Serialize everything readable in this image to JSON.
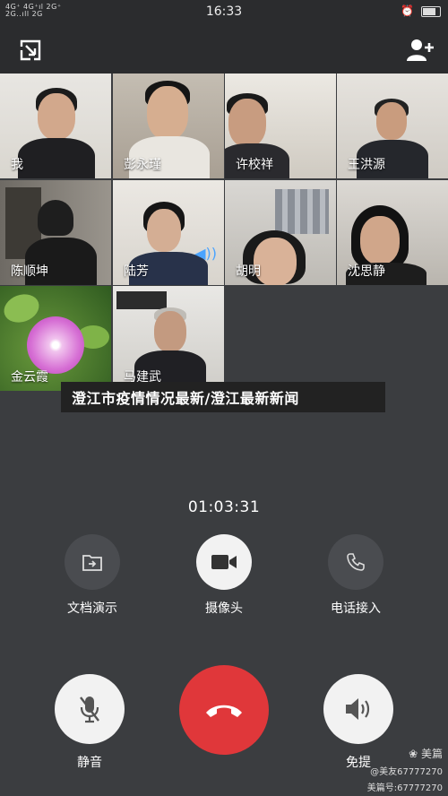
{
  "status_bar": {
    "signal_text_top": "4G+ 4G⁺ıl 2G",
    "signal_text_bottom": "4G+ 2G..ıll 2G",
    "time": "16:33"
  },
  "participants": [
    {
      "name": "我"
    },
    {
      "name": "彭永瑾"
    },
    {
      "name": "许校祥"
    },
    {
      "name": "王洪源"
    },
    {
      "name": "陈顺坤"
    },
    {
      "name": "陆芳"
    },
    {
      "name": "胡明"
    },
    {
      "name": "沈思静"
    },
    {
      "name": "金云霞"
    },
    {
      "name": "马建武"
    }
  ],
  "banner": {
    "text": "澄江市疫情情况最新/澄江最新新闻"
  },
  "call": {
    "duration": "01:03:31"
  },
  "controls_top": [
    {
      "label": "文档演示",
      "icon": "share-document-icon"
    },
    {
      "label": "摄像头",
      "icon": "video-camera-icon"
    },
    {
      "label": "电话接入",
      "icon": "phone-icon"
    }
  ],
  "controls_bottom": [
    {
      "label": "静音",
      "icon": "mic-muted-icon"
    },
    {
      "label": "",
      "icon": "hang-up-icon"
    },
    {
      "label": "免提",
      "icon": "speaker-icon"
    }
  ],
  "watermark": {
    "brand": "美篇",
    "line1": "@美友67777270",
    "line2": "美篇号:67777270"
  },
  "colors": {
    "background": "#3b3d40",
    "hangup": "#e0373a",
    "button": "#f2f2f2",
    "banner": "#222222"
  }
}
